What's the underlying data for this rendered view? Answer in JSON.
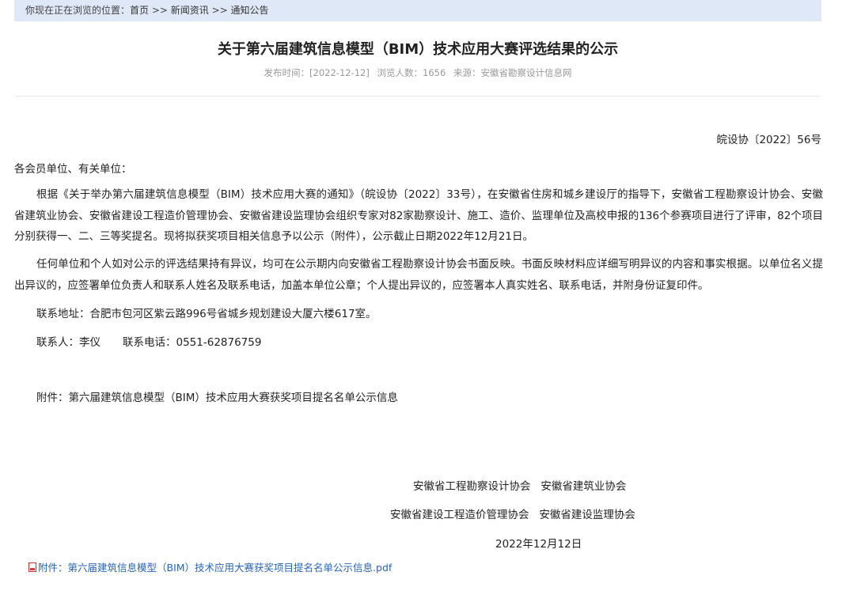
{
  "breadcrumb": {
    "prefix": "你现在正在浏览的位置：",
    "home": "首页",
    "sep1": " >> ",
    "news": "新闻资讯",
    "sep2": " >> ",
    "notice": "通知公告"
  },
  "article": {
    "title": "关于第六届建筑信息模型（BIM）技术应用大赛评选结果的公示",
    "meta": {
      "publish": "发布时间：[2022-12-12]",
      "views": "浏览人数：1656",
      "source": "来源：安徽省勘察设计信息网"
    },
    "doc_no": "皖设协〔2022〕56号",
    "salutation": "各会员单位、有关单位：",
    "paragraphs": [
      "根据《关于举办第六届建筑信息模型（BIM）技术应用大赛的通知》（皖设协〔2022〕33号），在安徽省住房和城乡建设厅的指导下，安徽省工程勘察设计协会、安徽省建筑业协会、安徽省建设工程造价管理协会、安徽省建设监理协会组织专家对82家勘察设计、施工、造价、监理单位及高校申报的136个参赛项目进行了评审，82个项目分别获得一、二、三等奖提名。现将拟获奖项目相关信息予以公示（附件），公示截止日期2022年12月21日。",
      "任何单位和个人如对公示的评选结果持有异议，均可在公示期内向安徽省工程勘察设计协会书面反映。书面反映材料应详细写明异议的内容和事实根据。以单位名义提出异议的，应签署单位负责人和联系人姓名及联系电话，加盖本单位公章；个人提出异议的，应签署本人真实姓名、联系电话，并附身份证复印件。",
      "联系地址：合肥市包河区紫云路996号省城乡规划建设大厦六楼617室。"
    ],
    "contact_person": "联系人：李仪",
    "contact_phone": "联系电话：0551-62876759",
    "attachment_text": "附件：第六届建筑信息模型（BIM）技术应用大赛获奖项目提名名单公示信息",
    "signature": {
      "line1": "安徽省工程勘察设计协会   安徽省建筑业协会",
      "line2": "安徽省建设工程造价管理协会   安徽省建设监理协会",
      "date": "2022年12月12日"
    },
    "attachment_link": "附件：第六届建筑信息模型（BIM）技术应用大赛获奖项目提名名单公示信息.pdf",
    "attachment_icon": "pdf-file-icon"
  }
}
